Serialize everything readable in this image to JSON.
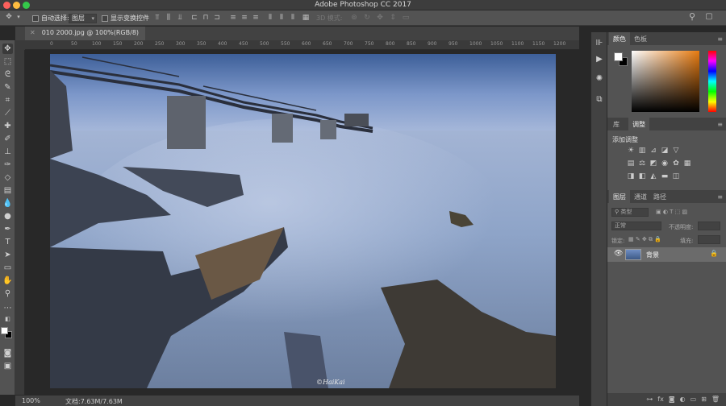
{
  "window": {
    "title": "Adobe Photoshop CC 2017"
  },
  "options": {
    "auto_select_label": "自动选择:",
    "auto_select_value": "图层",
    "show_transform_label": "显示变换控件",
    "mode_3d_label": "3D 模式:"
  },
  "document": {
    "tab_title": "010 2000.jpg @ 100%(RGB/8)",
    "zoom": "100%",
    "doc_size": "文档:7.63M/7.63M",
    "watermark": "©HaiKai"
  },
  "ruler": {
    "labels": [
      "0",
      "50",
      "100",
      "150",
      "200",
      "250",
      "300",
      "350",
      "400",
      "450",
      "500",
      "550",
      "600",
      "650",
      "700",
      "750",
      "800",
      "850",
      "900",
      "950",
      "1000",
      "1050",
      "1100",
      "1150",
      "1200"
    ]
  },
  "panels": {
    "color_tab": "颜色",
    "swatches_tab": "色板",
    "library_tab": "库",
    "adjustments_tab": "调整",
    "add_adjustment": "添加调整",
    "layers_tab": "图层",
    "channels_tab": "通道",
    "paths_tab": "路径",
    "filter_kind": "类型",
    "blend_mode": "正常",
    "opacity_label": "不透明度:",
    "lock_label": "锁定:",
    "fill_label": "填充:",
    "layer_name": "背景"
  }
}
